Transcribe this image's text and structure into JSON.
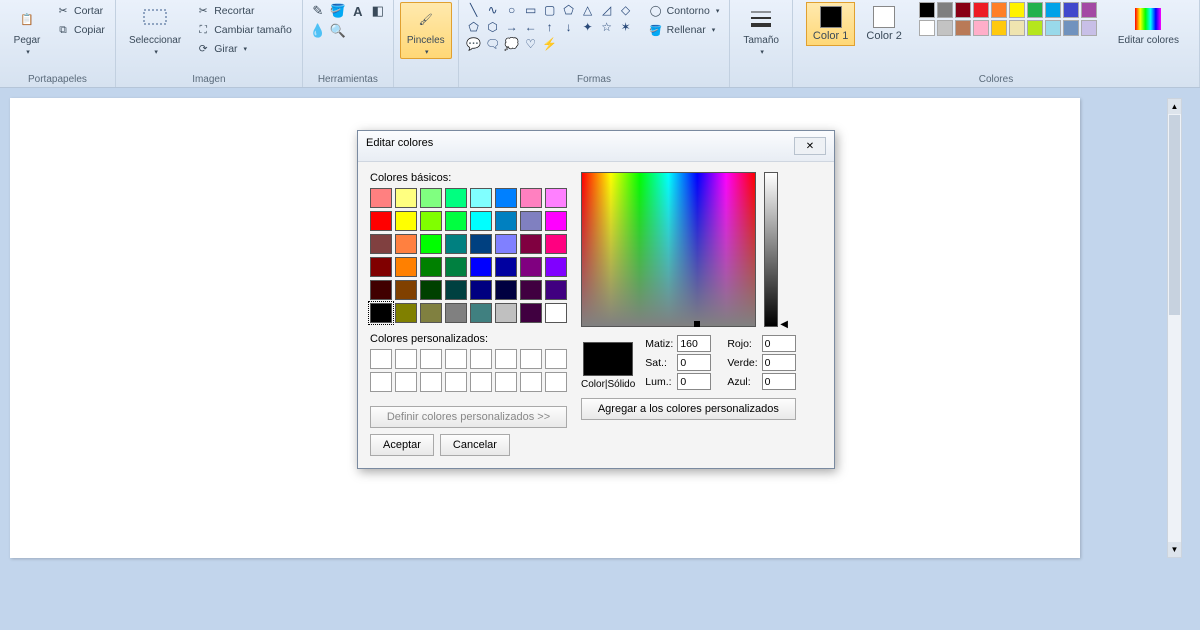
{
  "ribbon": {
    "pegar": "Pegar",
    "cortar": "Cortar",
    "copiar": "Copiar",
    "portapapeles": "Portapapeles",
    "seleccionar": "Seleccionar",
    "recortar": "Recortar",
    "cambiar_tamano": "Cambiar tamaño",
    "girar": "Girar",
    "imagen": "Imagen",
    "herramientas": "Herramientas",
    "pinceles": "Pinceles",
    "contorno": "Contorno",
    "rellenar": "Rellenar",
    "formas": "Formas",
    "tamano": "Tamaño",
    "color1": "Color 1",
    "color2": "Color 2",
    "colores_group": "Colores",
    "editar_colores": "Editar colores",
    "palette": [
      "#000000",
      "#7f7f7f",
      "#880015",
      "#ed1c24",
      "#ff7f27",
      "#fff200",
      "#22b14c",
      "#00a2e8",
      "#3f48cc",
      "#a349a4",
      "#ffffff",
      "#c3c3c3",
      "#b97a57",
      "#ffaec9",
      "#ffc90e",
      "#efe4b0",
      "#b5e61d",
      "#99d9ea",
      "#7092be",
      "#c8bfe7"
    ]
  },
  "dialog": {
    "title": "Editar colores",
    "basicos": "Colores básicos:",
    "personalizados": "Colores personalizados:",
    "definir": "Definir colores personalizados >>",
    "aceptar": "Aceptar",
    "cancelar": "Cancelar",
    "agregar": "Agregar a los colores personalizados",
    "color_solido": "Color|Sólido",
    "matiz": "Matiz:",
    "sat": "Sat.:",
    "lum": "Lum.:",
    "rojo": "Rojo:",
    "verde": "Verde:",
    "azul": "Azul:",
    "matiz_v": "160",
    "sat_v": "0",
    "lum_v": "0",
    "rojo_v": "0",
    "verde_v": "0",
    "azul_v": "0",
    "basic_colors": [
      "#ff8080",
      "#ffff80",
      "#80ff80",
      "#00ff80",
      "#80ffff",
      "#0080ff",
      "#ff80c0",
      "#ff80ff",
      "#ff0000",
      "#ffff00",
      "#80ff00",
      "#00ff40",
      "#00ffff",
      "#0080c0",
      "#8080c0",
      "#ff00ff",
      "#804040",
      "#ff8040",
      "#00ff00",
      "#008080",
      "#004080",
      "#8080ff",
      "#800040",
      "#ff0080",
      "#800000",
      "#ff8000",
      "#008000",
      "#008040",
      "#0000ff",
      "#0000a0",
      "#800080",
      "#8000ff",
      "#400000",
      "#804000",
      "#004000",
      "#004040",
      "#000080",
      "#000040",
      "#400040",
      "#400080",
      "#000000",
      "#808000",
      "#808040",
      "#808080",
      "#408080",
      "#c0c0c0",
      "#400040",
      "#ffffff"
    ]
  }
}
